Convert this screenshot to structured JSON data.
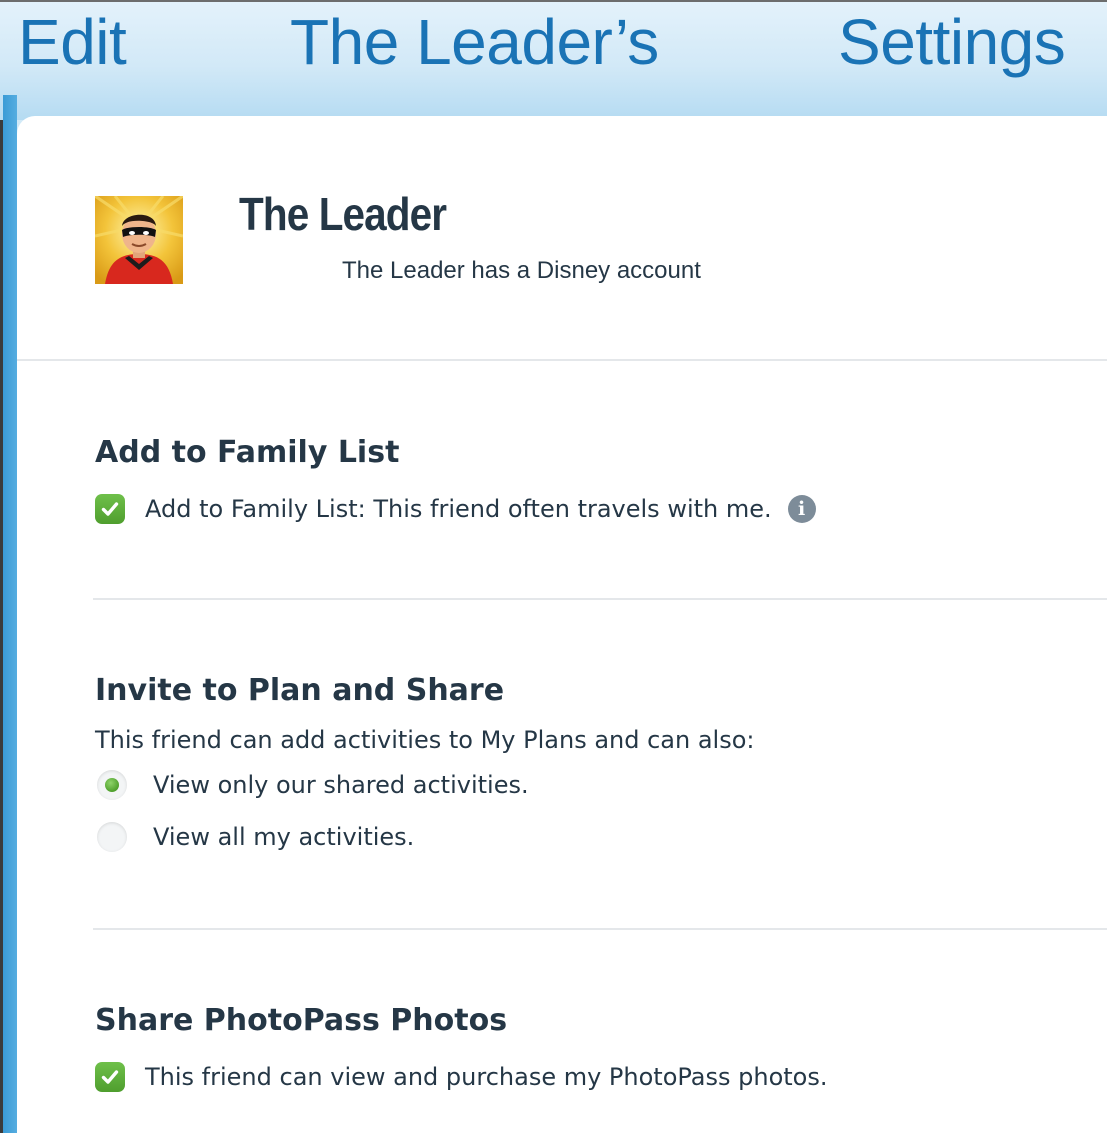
{
  "header": {
    "word_left": "Edit",
    "word_center": "The Leader’s",
    "word_right": "Settings"
  },
  "profile": {
    "name": "The Leader",
    "subtitle": "The Leader has a Disney account",
    "avatar_icon": "incredible-character-avatar"
  },
  "family_list": {
    "title": "Add to Family List",
    "checkbox_label": "Add to Family List: This friend often travels with me.",
    "checked": true,
    "info_icon": "info-icon",
    "info_glyph": "i"
  },
  "plan_share": {
    "title": "Invite to Plan and Share",
    "description": "This friend can add activities to My Plans and can also:",
    "options": [
      {
        "label": "View only our shared activities.",
        "selected": true
      },
      {
        "label": "View all my activities.",
        "selected": false
      }
    ]
  },
  "photopass": {
    "title": "Share PhotoPass Photos",
    "checkbox_label": "This friend can view and purchase my PhotoPass photos.",
    "checked": true
  },
  "colors": {
    "header_text": "#1a73b5",
    "body_text": "#253746",
    "check_green": "#5aad38",
    "accent_blue": "#3a9bd6"
  }
}
